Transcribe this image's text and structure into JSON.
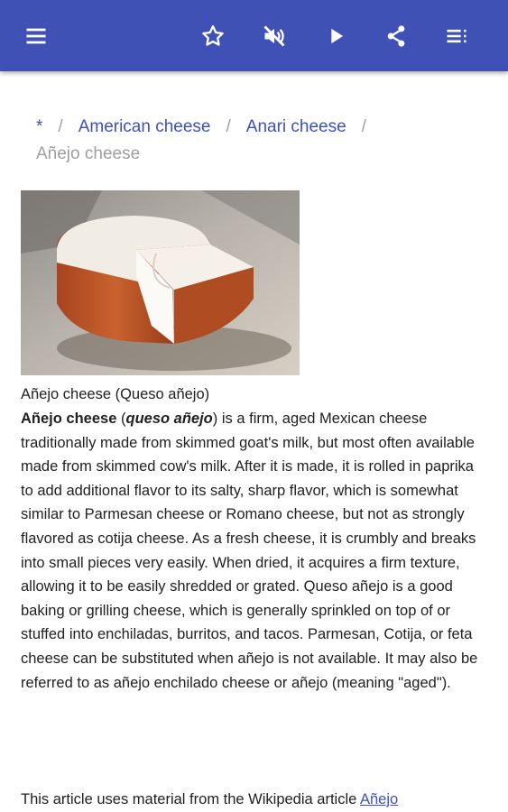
{
  "toolbar": {
    "icons": [
      "menu-icon",
      "star-icon",
      "volume-off-icon",
      "play-icon",
      "share-icon",
      "toc-icon"
    ],
    "background_color": "#3f51b5"
  },
  "breadcrumb": {
    "items": [
      "*",
      "American cheese",
      "Anari cheese"
    ],
    "separator": "/",
    "current": "Añejo cheese"
  },
  "image": {
    "caption": "Añejo cheese (Queso añejo)"
  },
  "article": {
    "title_bold": "Añejo cheese",
    "open_paren": " (",
    "alt_name": "queso añejo",
    "body": ") is a firm, aged Mexican cheese traditionally made from skimmed goat's milk, but most often available made from skimmed cow's milk. After it is made, it is rolled in paprika to add additional flavor to its salty, sharp flavor, which is somewhat similar to Parmesan cheese or Romano cheese, but not as strongly flavored as cotija cheese. As a fresh cheese, it is crumbly and breaks into small pieces very easily. When dried, it acquires a firm texture, allowing it to be easily shredded or grated. Queso añejo is a good baking or grilling cheese, which is generally sprinkled on top of or stuffed into enchiladas, burritos, and tacos. Parmesan, Cotija, or feta cheese can be substituted when añejo is not available. It may also be referred to as añejo enchilado cheese or añejo (meaning \"aged\")."
  },
  "attribution": {
    "text": "This article uses material from the Wikipedia article ",
    "link": "Añejo"
  },
  "colors": {
    "link": "#3f51b5",
    "muted": "#9e9e9e",
    "text": "#212121"
  }
}
